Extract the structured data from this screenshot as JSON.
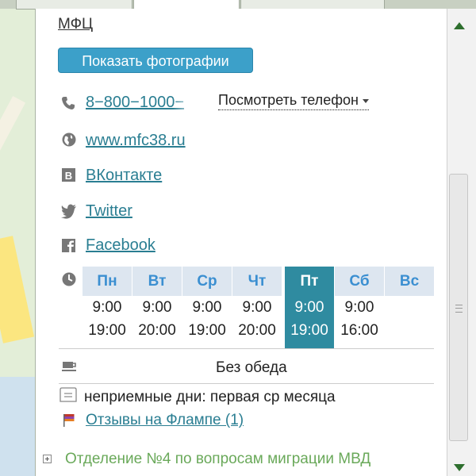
{
  "colors": {
    "link": "#2a7e92",
    "button": "#3ca0c9",
    "today": "#2f8ba0",
    "day_header": "#dde6f0",
    "day_text": "#3b8fd1",
    "related": "#6aa95a"
  },
  "org_name": "МФЦ",
  "photos_button": "Показать фотографии",
  "contacts": {
    "phone": "8−800−1000−",
    "show_phone": "Посмотреть телефон",
    "website": "www.mfc38.ru",
    "vk": "ВКонтакте",
    "twitter": "Twitter",
    "facebook": "Facebook"
  },
  "schedule": {
    "days": [
      {
        "name": "Пн",
        "open": "9:00",
        "close": "19:00"
      },
      {
        "name": "Вт",
        "open": "9:00",
        "close": "20:00"
      },
      {
        "name": "Ср",
        "open": "9:00",
        "close": "19:00"
      },
      {
        "name": "Чт",
        "open": "9:00",
        "close": "20:00"
      },
      {
        "name": "Пт",
        "open": "9:00",
        "close": "19:00"
      },
      {
        "name": "Сб",
        "open": "9:00",
        "close": "16:00"
      },
      {
        "name": "Вс",
        "open": "",
        "close": ""
      }
    ],
    "today_index": 4,
    "lunch": "Без обеда",
    "off_days": "неприемные дни: первая ср месяца"
  },
  "reviews_link": "Отзывы на Флампе (1)",
  "related": {
    "line1": "Отделение №4 по вопросам миграции МВД"
  },
  "icons": [
    "phone-icon",
    "globe-icon",
    "vk-icon",
    "twitter-icon",
    "facebook-icon",
    "clock-icon",
    "coffee-icon",
    "note-icon",
    "flamp-icon",
    "expand-icon"
  ]
}
